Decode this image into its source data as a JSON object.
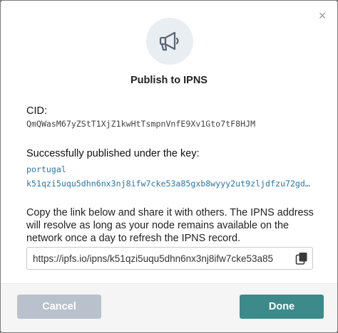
{
  "modal": {
    "close_symbol": "×",
    "icon": "megaphone-icon",
    "title": "Publish to IPNS"
  },
  "cid": {
    "label": "CID:",
    "value": "QmQWasM67yZStT1XjZ1kwHtTsmpnVnfE9Xv1Gto7tF8HJM"
  },
  "published": {
    "label": "Successfully published under the key:",
    "key_name": "portugal",
    "key_value": "k51qzi5uqu5dhn6nx3nj8ifw7cke53a85gxb8wyyy2ut9zljdfzu72gd…"
  },
  "description": "Copy the link below and share it with others. The IPNS address will resolve as long as your node remains available on the network once a day to refresh the IPNS record.",
  "link": {
    "value": "https://ipfs.io/ipns/k51qzi5uqu5dhn6nx3nj8ifw7cke53a85",
    "copy_icon": "copy-icon"
  },
  "footer": {
    "cancel_label": "Cancel",
    "done_label": "Done"
  },
  "colors": {
    "accent": "#3c8a8a",
    "cancel": "#b9c2cc",
    "link": "#2a78a8",
    "icon_bg": "#e9eef2"
  }
}
